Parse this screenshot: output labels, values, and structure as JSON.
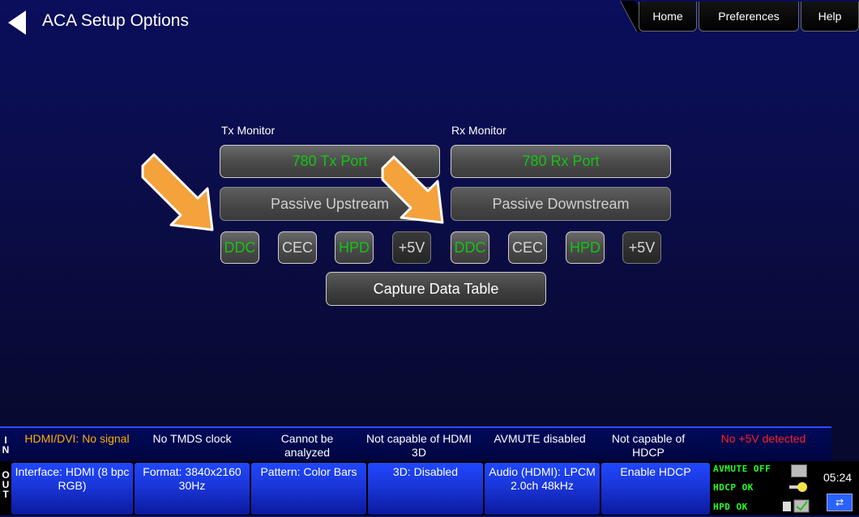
{
  "header": {
    "title": "ACA Setup Options",
    "nav": {
      "home": "Home",
      "preferences": "Preferences",
      "help": "Help"
    }
  },
  "tx": {
    "label": "Tx Monitor",
    "port": "780 Tx Port",
    "passive": "Passive Upstream",
    "ddc": "DDC",
    "cec": "CEC",
    "hpd": "HPD",
    "v5": "+5V"
  },
  "rx": {
    "label": "Rx Monitor",
    "port": "780 Rx Port",
    "passive": "Passive Downstream",
    "ddc": "DDC",
    "cec": "CEC",
    "hpd": "HPD",
    "v5": "+5V"
  },
  "capture_label": "Capture Data Table",
  "status_in": {
    "letters": [
      "I",
      "N"
    ],
    "hdmi": "HDMI/DVI: No signal",
    "tmds": "No TMDS clock",
    "analyzed": "Cannot be analyzed",
    "hdmi3d": "Not capable of HDMI 3D",
    "avmute": "AVMUTE disabled",
    "hdcp": "Not capable of HDCP",
    "v5": "No +5V detected"
  },
  "status_out": {
    "letters": [
      "O",
      "U",
      "T"
    ],
    "interface": "Interface: HDMI (8 bpc RGB)",
    "format": "Format: 3840x2160 30Hz",
    "pattern": "Pattern: Color Bars",
    "three_d": "3D: Disabled",
    "audio": "Audio (HDMI): LPCM 2.0ch 48kHz",
    "hdcp": "Enable HDCP",
    "avmute": "AVMUTE OFF",
    "hdcp_ok": "HDCP OK",
    "hpd_ok": "HPD OK",
    "time": "05:24"
  },
  "colors": {
    "active_green": "#14c414",
    "warn_orange": "#ffb000",
    "alert_red": "#ff2020",
    "status_green": "#20ff20",
    "arrow_orange": "#f4a23c"
  }
}
